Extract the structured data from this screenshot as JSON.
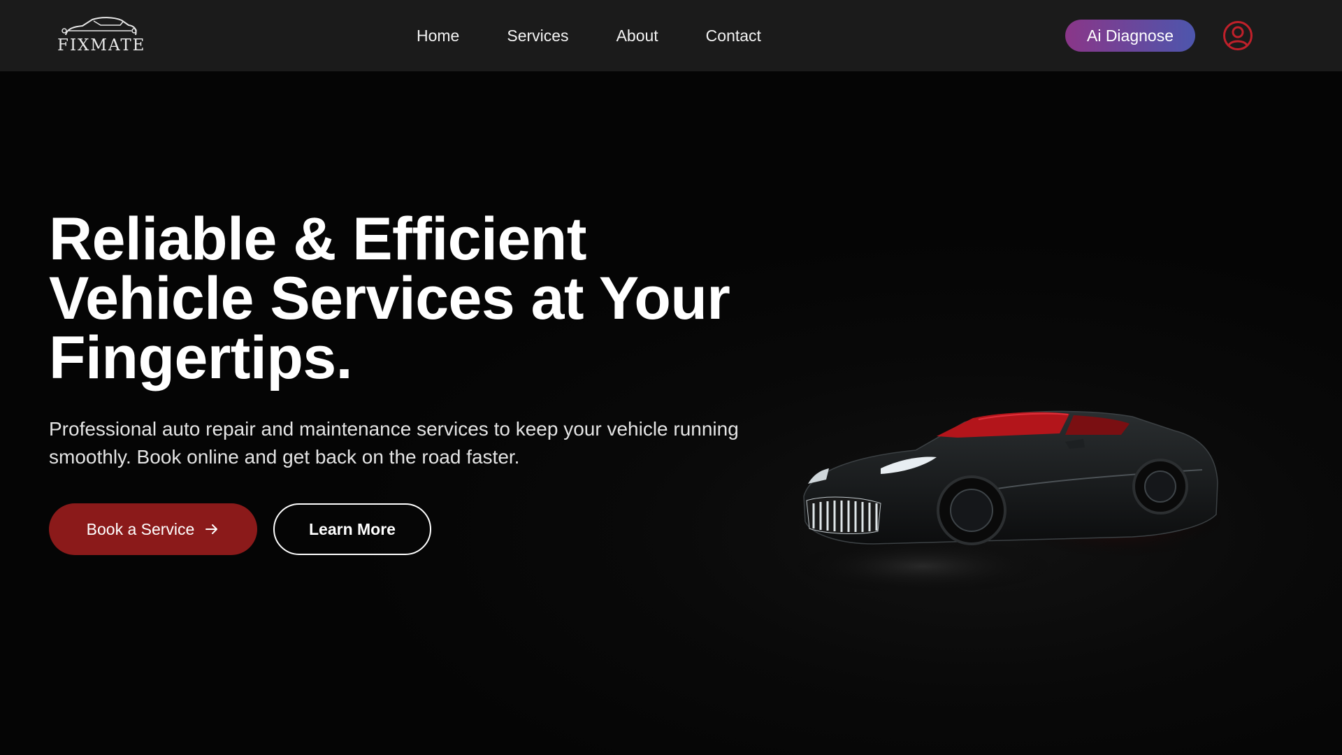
{
  "brand": {
    "logo_text": "FIXMATE",
    "logo_icon": "car-outline-icon"
  },
  "nav": {
    "links": [
      "Home",
      "Services",
      "About",
      "Contact"
    ],
    "ai_button_label": "Ai Diagnose",
    "user_icon": "user-circle-icon"
  },
  "hero": {
    "title_lines": [
      "Reliable & Efficient",
      "Vehicle Services at Your",
      "Fingertips."
    ],
    "description": "Professional auto repair and maintenance services to keep your vehicle running smoothly. Book online and get back on the road faster.",
    "primary_button_label": "Book a Service",
    "primary_button_icon": "arrow-right-icon",
    "secondary_button_label": "Learn More",
    "image": "sports-car-image"
  },
  "colors": {
    "nav_background": "#1b1b1b",
    "page_background": "#060606",
    "primary_button": "#8b1a1a",
    "ai_gradient_start": "#8a3688",
    "ai_gradient_end": "#4d56ad",
    "user_icon": "#c0202a"
  }
}
